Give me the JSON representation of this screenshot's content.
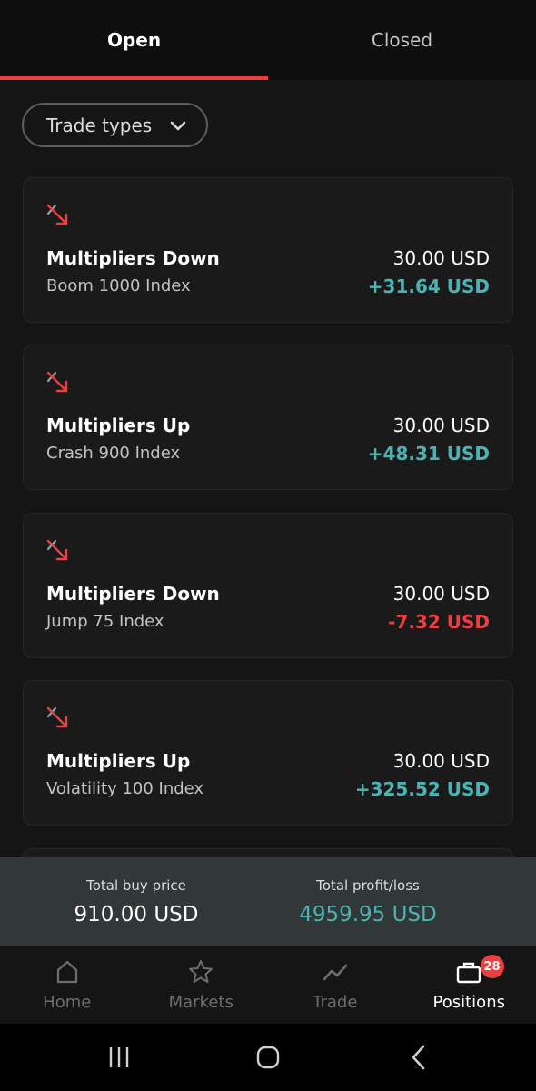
{
  "tabs": [
    {
      "label": "Open",
      "active": true
    },
    {
      "label": "Closed",
      "active": false
    }
  ],
  "filter": {
    "label": "Trade types",
    "icon": "chevron-down-icon"
  },
  "positions": [
    {
      "title": "Multipliers Down",
      "market": "Boom 1000 Index",
      "buy_price": "30.00 USD",
      "profit_loss": "+31.64 USD",
      "pl_sign": "positive",
      "icon": "multipliers-down-icon"
    },
    {
      "title": "Multipliers Up",
      "market": "Crash 900 Index",
      "buy_price": "30.00 USD",
      "profit_loss": "+48.31 USD",
      "pl_sign": "positive",
      "icon": "multipliers-down-icon"
    },
    {
      "title": "Multipliers Down",
      "market": "Jump 75 Index",
      "buy_price": "30.00 USD",
      "profit_loss": "-7.32 USD",
      "pl_sign": "negative",
      "icon": "multipliers-down-icon"
    },
    {
      "title": "Multipliers Up",
      "market": "Volatility 100 Index",
      "buy_price": "30.00 USD",
      "profit_loss": "+325.52 USD",
      "pl_sign": "positive",
      "icon": "multipliers-down-icon"
    }
  ],
  "totals": {
    "buy_price_label": "Total buy price",
    "buy_price_value": "910.00 USD",
    "profit_loss_label": "Total profit/loss",
    "profit_loss_value": "4959.95 USD"
  },
  "bottom_nav": [
    {
      "label": "Home",
      "icon": "home-icon",
      "active": false
    },
    {
      "label": "Markets",
      "icon": "star-icon",
      "active": false
    },
    {
      "label": "Trade",
      "icon": "trend-line-icon",
      "active": false
    },
    {
      "label": "Positions",
      "icon": "briefcase-icon",
      "active": true,
      "badge": "28"
    }
  ],
  "colors": {
    "accent_red": "#ec3f3f",
    "profit_green": "#4bb4b3",
    "background": "#151515",
    "card": "#1a1a1a"
  }
}
